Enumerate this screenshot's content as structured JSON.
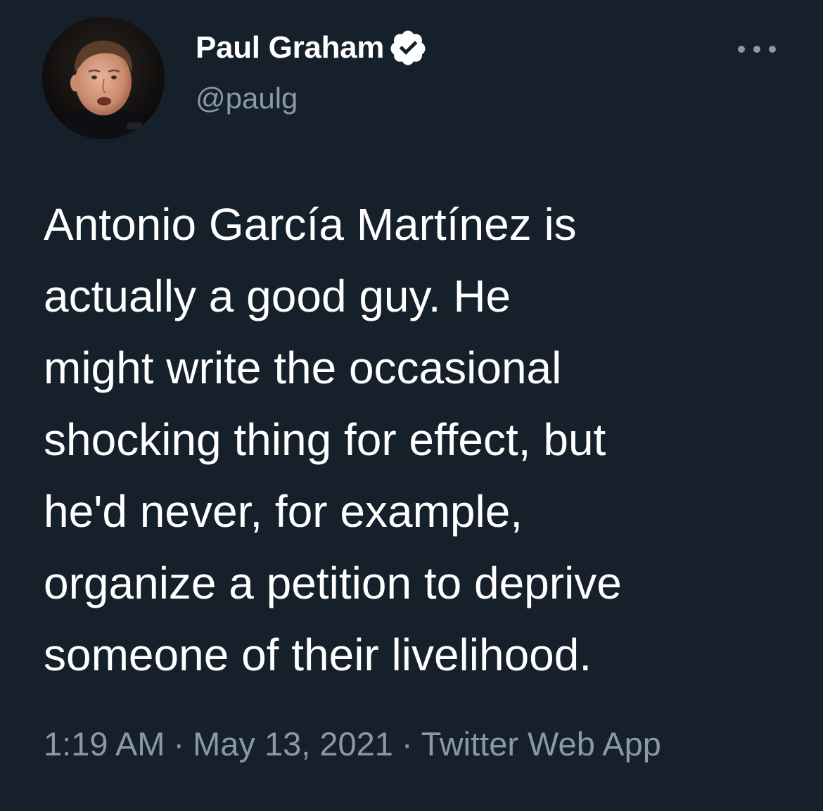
{
  "colors": {
    "background": "#15202b",
    "primary_text": "#ffffff",
    "secondary_text": "#8b98a5",
    "verified_badge": "#ffffff",
    "verified_check": "#15202b"
  },
  "author": {
    "display_name": "Paul Graham",
    "handle": "@paulg",
    "verified": true,
    "verified_icon": "verified-badge-icon",
    "avatar_icon": "profile-photo"
  },
  "menu": {
    "icon": "more-options-icon"
  },
  "tweet": {
    "text_lines": [
      "Antonio García Martínez is",
      "actually a good guy. He",
      "might write the occasional",
      "shocking thing for effect, but",
      "he'd never, for example,",
      "organize a petition to deprive",
      "someone of their livelihood."
    ]
  },
  "meta": {
    "time": "1:19 AM",
    "date": "May 13, 2021",
    "source": "Twitter Web App",
    "separator": "·"
  }
}
